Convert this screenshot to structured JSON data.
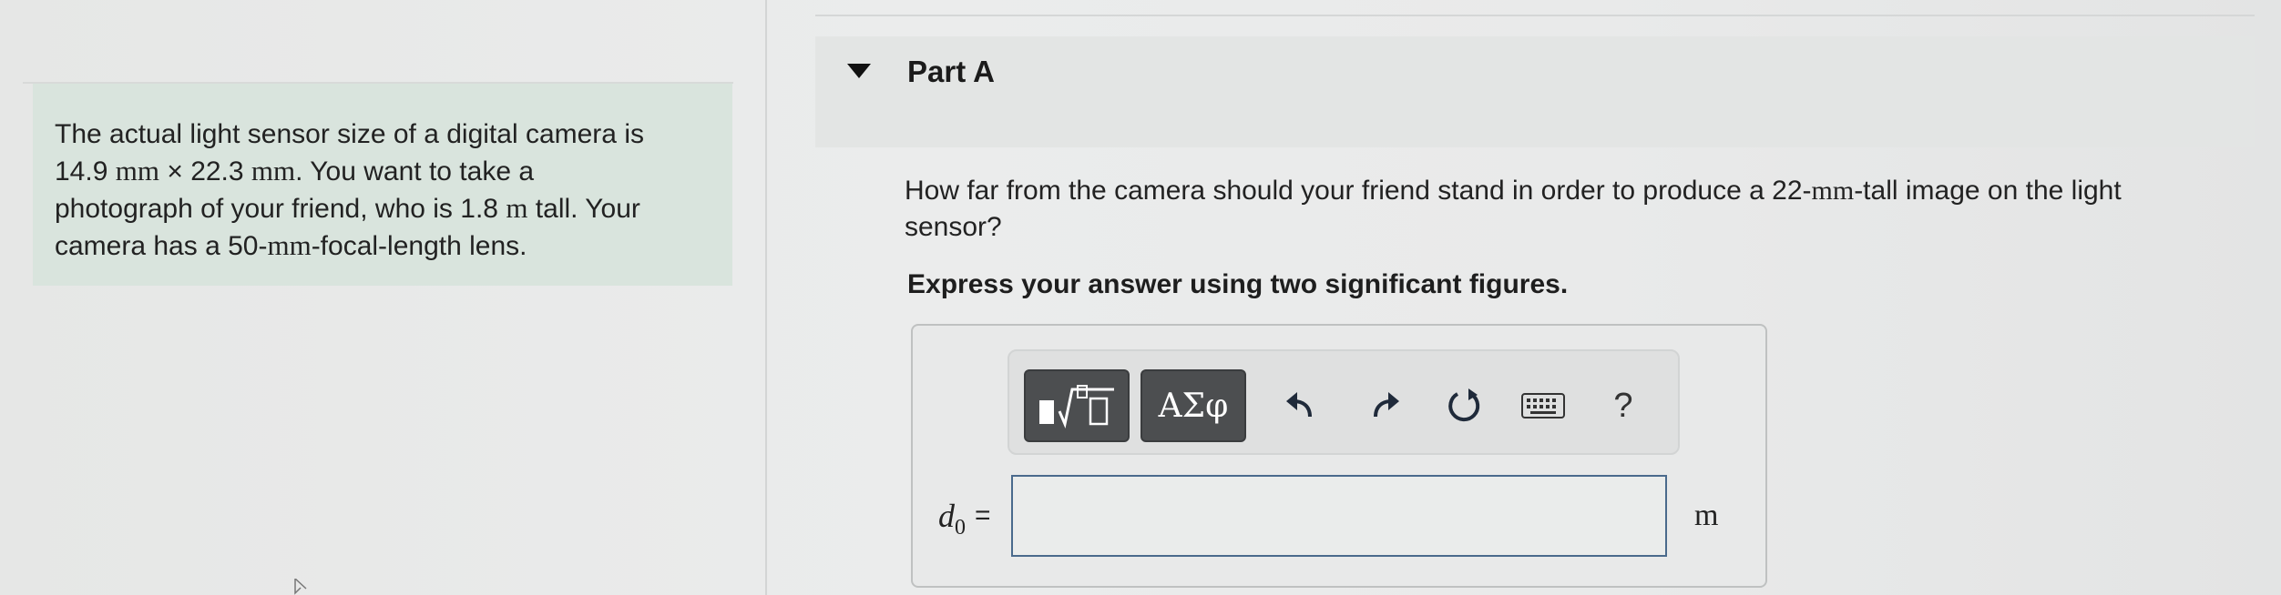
{
  "problem": {
    "line1": "The actual light sensor size of a digital camera is",
    "dim1": "14.9",
    "unit_mm": "mm",
    "times": "×",
    "dim2": "22.3",
    "line2_rest": ". You want to take a",
    "line3_start": "photograph of your friend, who is 1.8",
    "unit_m": "m",
    "line3_end": "tall. Your",
    "line4_start": "camera has a 50-",
    "line4_end": "-focal-length lens."
  },
  "part": {
    "title": "Part A"
  },
  "question": {
    "text_start": "How far from the camera should your friend stand in order to produce a 22-",
    "unit_mm": "mm",
    "text_end": "-tall image on the light sensor?"
  },
  "instruction": "Express your answer using two significant figures.",
  "toolbar": {
    "templates_label": "▮√▯",
    "greek_label": "ΑΣφ",
    "help_label": "?"
  },
  "answer": {
    "variable": "d",
    "subscript": "0",
    "equals": "=",
    "value": "",
    "unit": "m"
  }
}
